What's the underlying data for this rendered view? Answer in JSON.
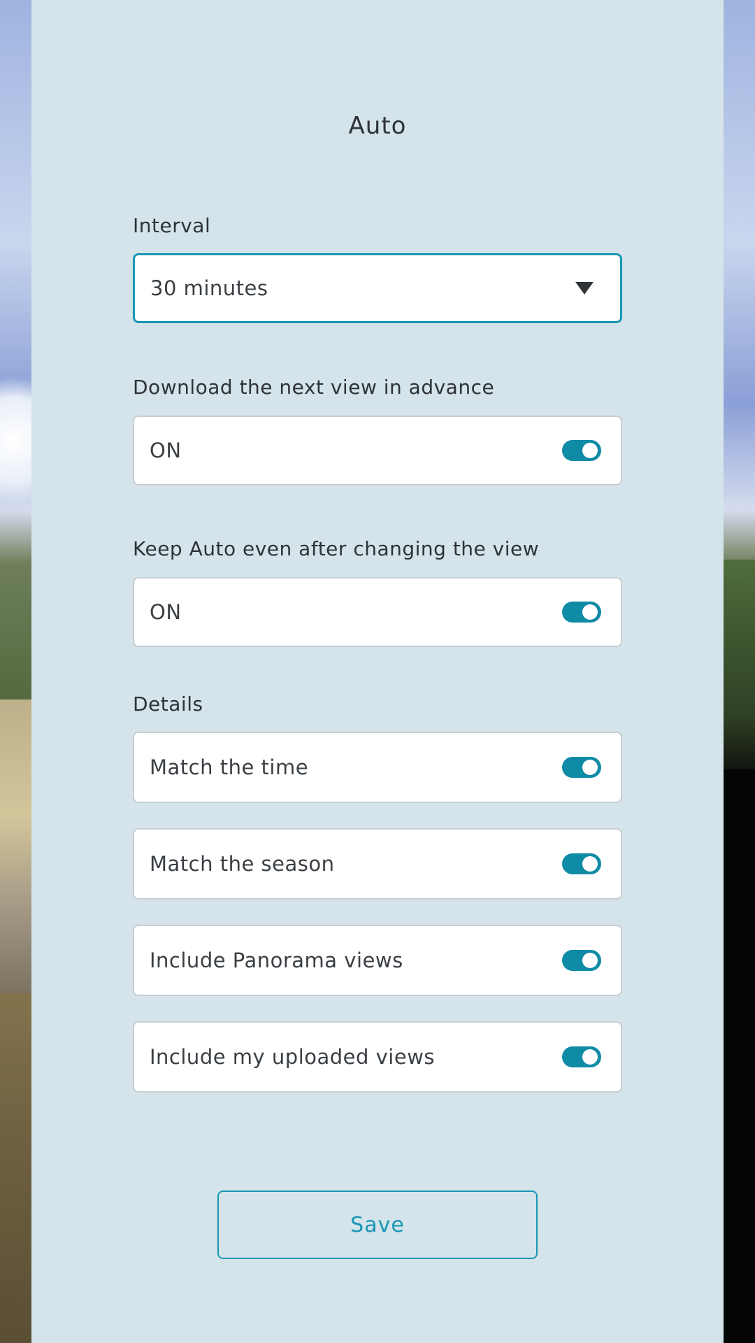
{
  "title": "Auto",
  "interval": {
    "label": "Interval",
    "value": "30 minutes"
  },
  "download_next": {
    "label": "Download the next view in advance",
    "value": "ON",
    "enabled": true
  },
  "keep_auto": {
    "label": "Keep Auto even after changing the view",
    "value": "ON",
    "enabled": true
  },
  "details": {
    "label": "Details",
    "items": [
      {
        "label": "Match the time",
        "enabled": true
      },
      {
        "label": "Match the season",
        "enabled": true
      },
      {
        "label": "Include Panorama views",
        "enabled": true
      },
      {
        "label": "Include my uploaded views",
        "enabled": true
      }
    ]
  },
  "save_label": "Save",
  "colors": {
    "accent": "#1a96b6",
    "toggle_on": "#0f8ba6",
    "panel_bg": "#d4e4ea"
  }
}
